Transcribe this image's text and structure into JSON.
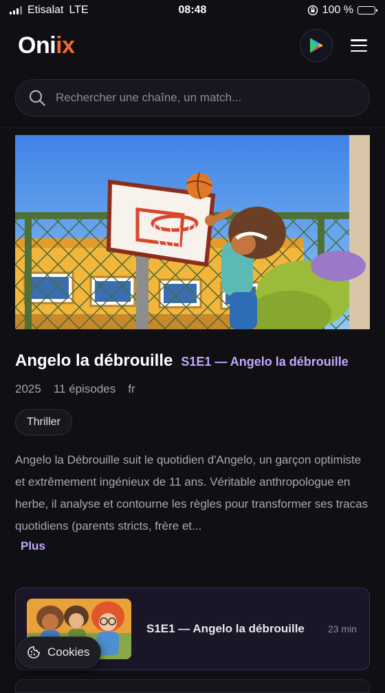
{
  "status_bar": {
    "carrier": "Etisalat",
    "network": "LTE",
    "time": "08:48",
    "battery": "100 %"
  },
  "header": {
    "logo_prefix": "Oni",
    "logo_accent": "ix",
    "play_icon": "play-store-icon",
    "menu_icon": "hamburger-menu-icon"
  },
  "search": {
    "placeholder": "Rechercher une chaîne, un match..."
  },
  "show": {
    "title": "Angelo la débrouille",
    "episode": "S1E1 — Angelo la débrouille",
    "year": "2025",
    "episodes": "11 épisodes",
    "language": "fr",
    "genre": "Thriller",
    "description": "Angelo la Débrouille suit le quotidien d'Angelo, un garçon optimiste et extrêmement ingénieux de 11 ans. Véritable anthropologue en herbe, il analyse et contourne les règles pour transformer ses tracas quotidiens (parents stricts, frère et...",
    "more_label": "Plus"
  },
  "episode_list": [
    {
      "title": "S1E1 — Angelo la débrouille",
      "duration": "23 min"
    }
  ],
  "cookies": {
    "label": "Cookies",
    "icon": "cookie-icon"
  },
  "colors": {
    "background": "#0f0f14",
    "accent_logo": "#f26a2e",
    "accent_purple": "#c4a8ff"
  }
}
